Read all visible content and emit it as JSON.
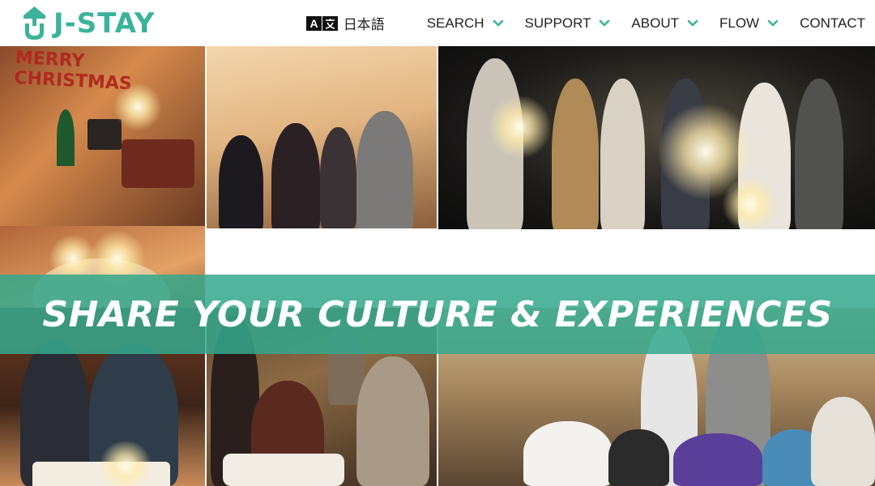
{
  "brand": {
    "name": "J-STAY",
    "color": "#3bb39a"
  },
  "header": {
    "language": {
      "icon": "translate-icon",
      "label": "日本語"
    },
    "nav": [
      {
        "label": "SEARCH",
        "has_dropdown": true
      },
      {
        "label": "SUPPORT",
        "has_dropdown": true
      },
      {
        "label": "ABOUT",
        "has_dropdown": true
      },
      {
        "label": "FLOW",
        "has_dropdown": true
      },
      {
        "label": "CONTACT",
        "has_dropdown": false
      }
    ]
  },
  "hero": {
    "headline": "SHARE YOUR CULTURE & EXPERIENCES",
    "banner_color": "#34a88c",
    "photo_texts": {
      "christmas_sign": "MERRY CHRISTMAS"
    }
  }
}
